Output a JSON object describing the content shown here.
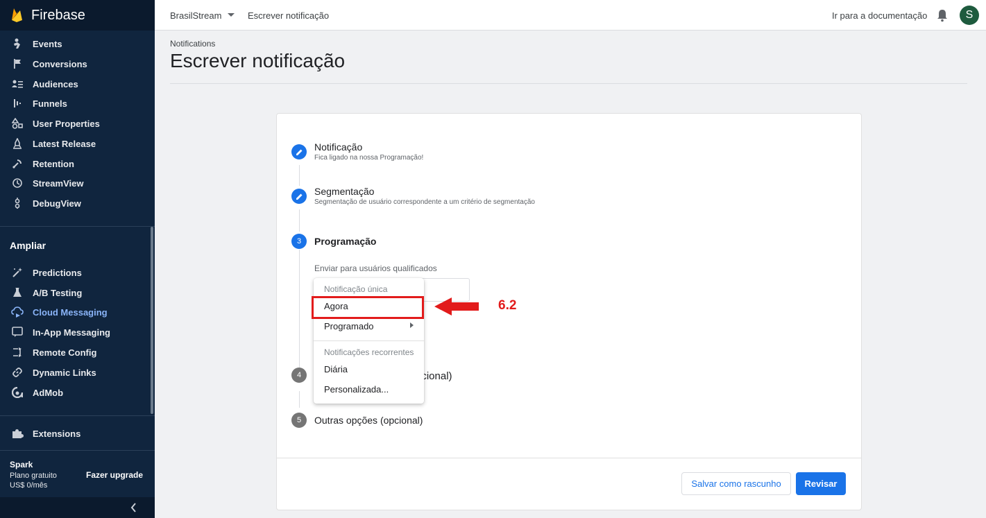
{
  "sidebar": {
    "brand": "Firebase",
    "items": [
      {
        "label": "Events",
        "icon": "events-icon"
      },
      {
        "label": "Conversions",
        "icon": "flag-icon"
      },
      {
        "label": "Audiences",
        "icon": "audiences-icon"
      },
      {
        "label": "Funnels",
        "icon": "funnels-icon"
      },
      {
        "label": "User Properties",
        "icon": "shapes-icon"
      },
      {
        "label": "Latest Release",
        "icon": "release-icon"
      },
      {
        "label": "Retention",
        "icon": "retention-icon"
      },
      {
        "label": "StreamView",
        "icon": "clock-icon"
      },
      {
        "label": "DebugView",
        "icon": "debug-icon"
      }
    ],
    "section_title": "Ampliar",
    "grow_items": [
      {
        "label": "Predictions",
        "icon": "predictions-icon"
      },
      {
        "label": "A/B Testing",
        "icon": "flask-icon"
      },
      {
        "label": "Cloud Messaging",
        "icon": "cloud-messaging-icon",
        "active": true
      },
      {
        "label": "In-App Messaging",
        "icon": "in-app-messaging-icon"
      },
      {
        "label": "Remote Config",
        "icon": "remote-config-icon"
      },
      {
        "label": "Dynamic Links",
        "icon": "link-icon"
      },
      {
        "label": "AdMob",
        "icon": "admob-icon"
      }
    ],
    "extensions_label": "Extensions",
    "plan": {
      "name": "Spark",
      "type": "Plano gratuito",
      "price": "US$ 0/mês"
    },
    "upgrade_label": "Fazer upgrade"
  },
  "topbar": {
    "project": "BrasilStream",
    "crumb": "Escrever notificação",
    "docs_link": "Ir para a documentação",
    "avatar_letter": "S"
  },
  "page": {
    "breadcrumb": "Notifications",
    "title": "Escrever notificação"
  },
  "steps": [
    {
      "number": "",
      "title": "Notificação",
      "subtitle": "Fica ligado na nossa Programação!"
    },
    {
      "number": "",
      "title": "Segmentação",
      "subtitle": "Segmentação de usuário correspondente a um critério de segmentação"
    },
    {
      "number": "3",
      "title": "Programação",
      "subtitle": ""
    },
    {
      "number": "4",
      "title": "Eventos de conversão (opcional)",
      "visible_fragment": "pcional)"
    },
    {
      "number": "5",
      "title": "Outras opções (opcional)"
    }
  ],
  "schedule": {
    "field_label": "Enviar para usuários qualificados"
  },
  "menu": {
    "header_once": "Notificação única",
    "now": "Agora",
    "scheduled": "Programado",
    "header_recurring": "Notificações recorrentes",
    "daily": "Diária",
    "custom": "Personalizada..."
  },
  "buttons": {
    "draft": "Salvar como rascunho",
    "review": "Revisar"
  },
  "annotation": {
    "label": "6.2",
    "color": "#e21b1b"
  },
  "colors": {
    "sidebar_bg": "#10253e",
    "accent": "#1a73e8",
    "active_nav": "#8ab4f8"
  }
}
